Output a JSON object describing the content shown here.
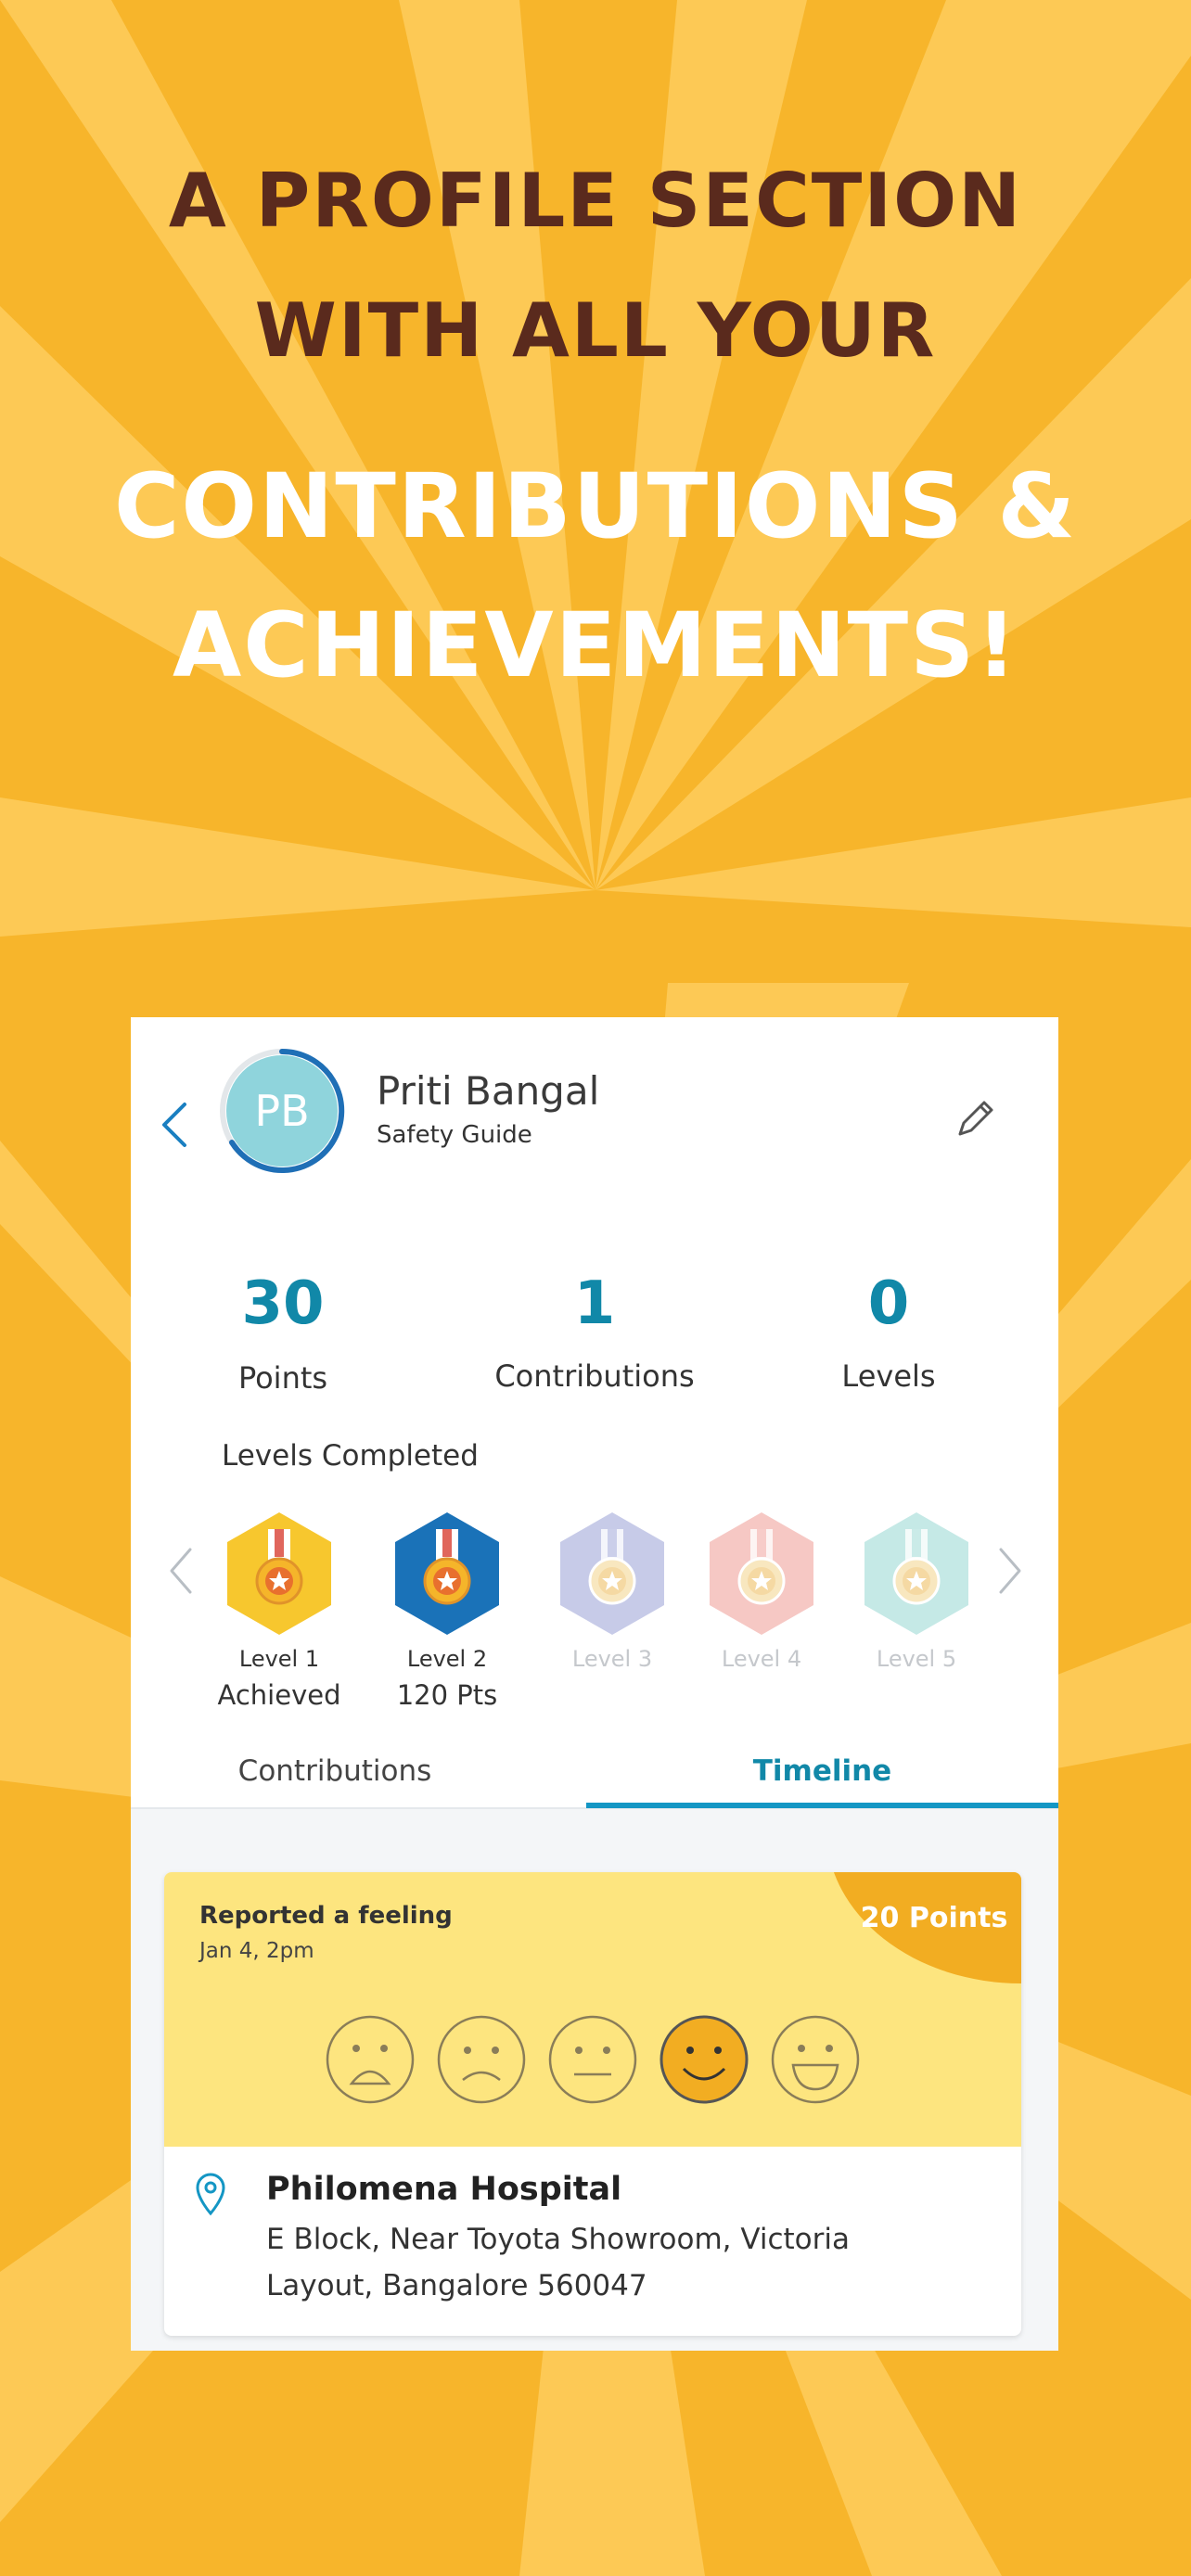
{
  "headline": {
    "line1": "A PROFILE SECTION",
    "line2": "WITH ALL YOUR",
    "line3": "CONTRIBUTIONS &",
    "line4": "ACHIEVEMENTS!"
  },
  "colors": {
    "background": "#f7b52b",
    "ray": "#fdc955",
    "accent": "#1188a8",
    "avatar": "#8fd4dc"
  },
  "profile": {
    "initials": "PB",
    "name": "Priti Bangal",
    "role": "Safety Guide",
    "icons": {
      "back": "chevron-left-icon",
      "edit": "pencil-icon"
    }
  },
  "stats": [
    {
      "value": "30",
      "label": "Points"
    },
    {
      "value": "1",
      "label": "Contributions"
    },
    {
      "value": "0",
      "label": "Levels"
    }
  ],
  "levels": {
    "title": "Levels Completed",
    "items": [
      {
        "label": "Level 1",
        "sub": "Achieved",
        "color": "#f7c72e"
      },
      {
        "label": "Level 2",
        "sub": "120 Pts",
        "color": "#1a72b8"
      },
      {
        "label": "Level 3",
        "sub": "",
        "color": "#c7cbe8"
      },
      {
        "label": "Level 4",
        "sub": "",
        "color": "#f6c8c4"
      },
      {
        "label": "Level 5",
        "sub": "",
        "color": "#c5e9e6"
      }
    ]
  },
  "tabs": [
    {
      "label": "Contributions",
      "active": false
    },
    {
      "label": "Timeline",
      "active": true
    }
  ],
  "timeline_card": {
    "title": "Reported a feeling",
    "date": "Jan 4, 2pm",
    "points": "20 Points",
    "selected_face_index": 3,
    "faces": [
      "shocked-face-icon",
      "sad-face-icon",
      "neutral-face-icon",
      "smile-face-icon",
      "happy-face-icon"
    ],
    "location_name": "Philomena Hospital",
    "address_line1": "E Block, Near Toyota Showroom, Victoria",
    "address_line2": "Layout, Bangalore 560047"
  }
}
